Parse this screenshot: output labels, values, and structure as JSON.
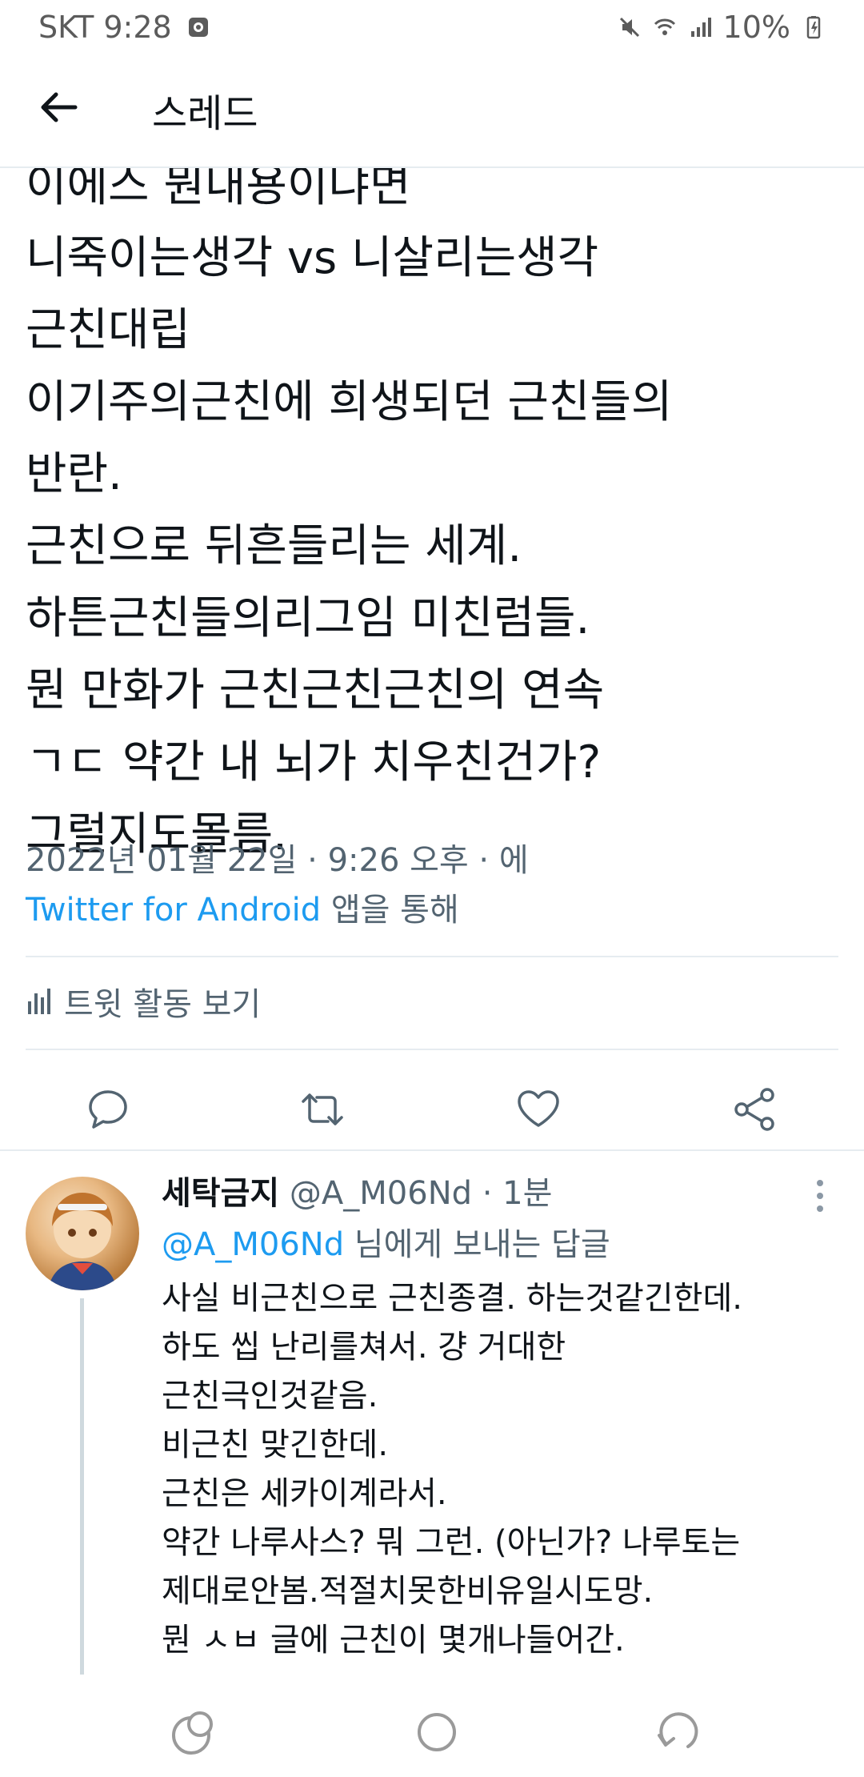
{
  "status_bar": {
    "carrier_time": "SKT 9:28",
    "battery": "10%"
  },
  "header": {
    "title": "스레드"
  },
  "tweet": {
    "body": "이에스 뭔내용이냐면\n니죽이는생각 vs 니살리는생각\n근친대립\n이기주의근친에 희생되던 근친들의\n반란.\n근친으로 뒤흔들리는 세계.\n하튼근친들의리그임 미친럼들.\n뭔 만화가 근친근친근친의 연속\n ㄱㄷ 약간 내 뇌가 치우친건가?\n그럴지도몰름.",
    "timestamp": "2022년 01월 22일 · 9:26 오후 · 에",
    "source": "Twitter for Android",
    "source_suffix": " 앱을 통해",
    "activity_label": "트윗 활동 보기"
  },
  "reply": {
    "name": "세탁금지",
    "handle_time": " @A_M06Nd · 1분",
    "reply_to_mention": "@A_M06Nd",
    "reply_to_suffix": " 님에게 보내는 답글",
    "body": "사실 비근친으로 근친종결. 하는것같긴한데.\n하도 씹 난리를쳐서. 걍 거대한\n근친극인것같음.\n비근친 맞긴한데.\n근친은 세카이계라서.\n약간 나루사스? 뭐 그런. (아닌가? 나루토는\n제대로안봄.적절치못한비유일시도망.\n뭔 ㅅㅂ 글에 근친이 몇개나들어간."
  },
  "colors": {
    "accent": "#1d9bf0",
    "secondary_text": "#536471",
    "divider": "#e6ecf0"
  },
  "icons": [
    "back-arrow-icon",
    "activity-chart-icon",
    "reply-icon",
    "retweet-icon",
    "like-icon",
    "share-icon",
    "more-vertical-icon",
    "recent-apps-icon",
    "home-icon",
    "back-nav-icon"
  ]
}
